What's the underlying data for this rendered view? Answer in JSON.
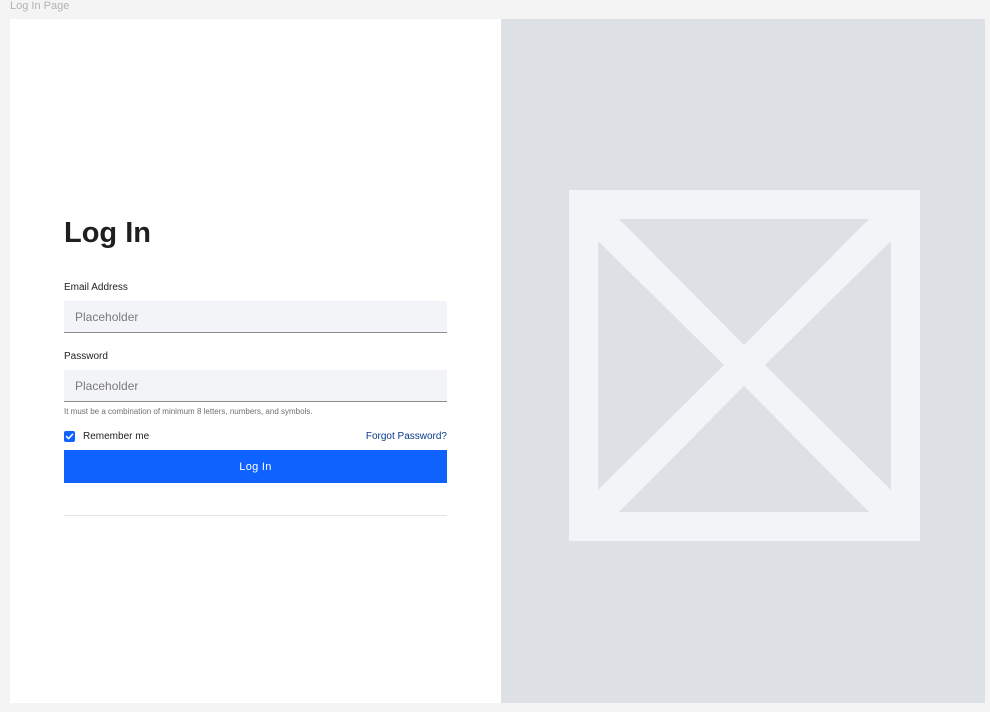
{
  "page": {
    "frame_label": "Log In Page"
  },
  "login": {
    "title": "Log In",
    "email_label": "Email Address",
    "email_placeholder": "Placeholder",
    "email_value": "",
    "password_label": "Password",
    "password_placeholder": "Placeholder",
    "password_value": "",
    "password_hint": "It must be a combination of minimum 8 letters, numbers, and symbols.",
    "remember_label": "Remember me",
    "remember_checked": true,
    "forgot_label": "Forgot Password?",
    "submit_label": "Log In"
  },
  "hero": {
    "icon": "image-placeholder-icon"
  },
  "colors": {
    "primary": "#0f62fe",
    "field_bg": "#f2f4f8",
    "hero_bg": "#dde0e4",
    "placeholder_frame": "#f2f4f8",
    "link": "#0a3a8c"
  }
}
